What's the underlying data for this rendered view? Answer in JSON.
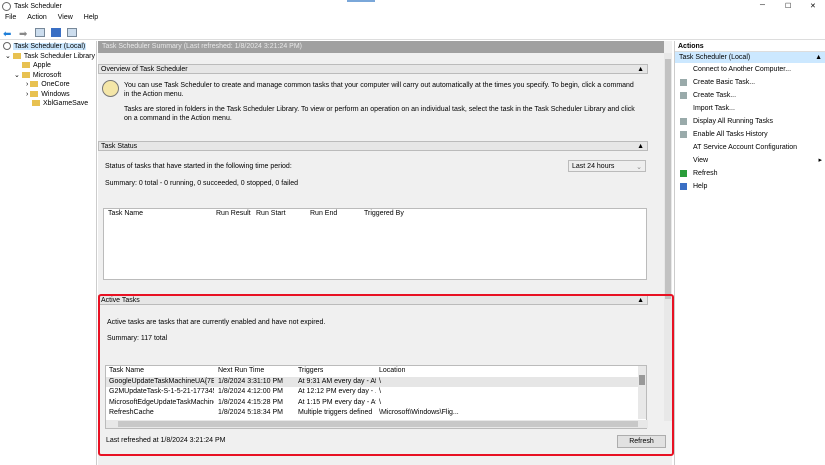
{
  "window": {
    "title": "Task Scheduler",
    "minimize": "─",
    "maximize": "☐",
    "close": "✕"
  },
  "menu": [
    "File",
    "Action",
    "View",
    "Help"
  ],
  "tree": {
    "root": "Task Scheduler (Local)",
    "library": "Task Scheduler Library",
    "items": [
      "Apple",
      "Microsoft",
      "OneCore",
      "Windows",
      "XblGameSave"
    ]
  },
  "main": {
    "header": "Task Scheduler Summary (Last refreshed: 1/8/2024 3:21:24 PM)",
    "overview": {
      "title": "Overview of Task Scheduler",
      "p1": "You can use Task Scheduler to create and manage common tasks that your computer will carry out automatically at the times you specify. To begin, click a command in the Action menu.",
      "p2": "Tasks are stored in folders in the Task Scheduler Library. To view or perform an operation on an individual task, select the task in the Task Scheduler Library and click on a command in the Action menu."
    },
    "status": {
      "title": "Task Status",
      "label": "Status of tasks that have started in the following time period:",
      "period": "Last 24 hours",
      "summary": "Summary: 0 total - 0 running, 0 succeeded, 0 stopped, 0 failed",
      "columns": [
        "Task Name",
        "Run Result",
        "Run Start",
        "Run End",
        "Triggered By"
      ]
    },
    "active": {
      "title": "Active Tasks",
      "desc": "Active tasks are tasks that are currently enabled and have not expired.",
      "summary": "Summary: 117 total",
      "columns": [
        "Task Name",
        "Next Run Time",
        "Triggers",
        "Location"
      ],
      "rows": [
        [
          "GoogleUpdateTaskMachineUA{7B2...",
          "1/8/2024 3:31:10 PM",
          "At 9:31 AM every day - Af...",
          "\\"
        ],
        [
          "G2MUpdateTask-S-1-5-21-1773452...",
          "1/8/2024 4:12:00 PM",
          "At 12:12 PM every day - ...",
          "\\"
        ],
        [
          "MicrosoftEdgeUpdateTaskMachine...",
          "1/8/2024 4:15:28 PM",
          "At 1:15 PM every day - Af...",
          "\\"
        ],
        [
          "RefreshCache",
          "1/8/2024 5:18:34 PM",
          "Multiple triggers defined",
          "\\Microsoft\\Windows\\Flig..."
        ]
      ]
    },
    "last_refreshed": "Last refreshed at 1/8/2024 3:21:24 PM",
    "refresh_button": "Refresh"
  },
  "actions": {
    "title": "Actions",
    "group": "Task Scheduler (Local)",
    "items": [
      "Connect to Another Computer...",
      "Create Basic Task...",
      "Create Task...",
      "Import Task...",
      "Display All Running Tasks",
      "Enable All Tasks History",
      "AT Service Account Configuration",
      "View",
      "Refresh",
      "Help"
    ]
  },
  "colors": {
    "highlight": "#e81123",
    "selection": "#cce8ff"
  }
}
